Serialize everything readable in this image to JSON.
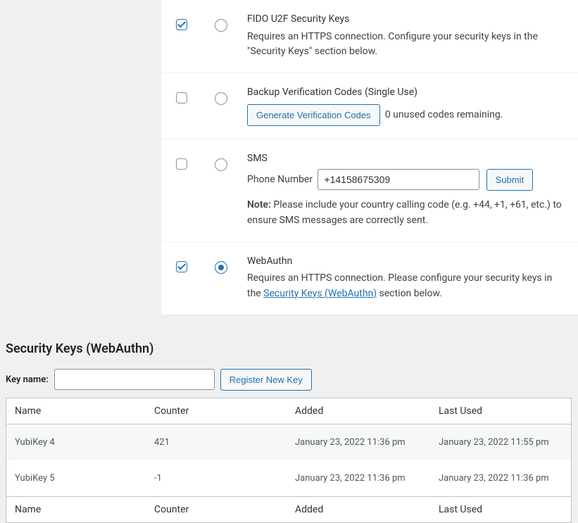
{
  "methods": {
    "fido": {
      "enabled": true,
      "primary": false,
      "title": "FIDO U2F Security Keys",
      "desc": "Requires an HTTPS connection. Configure your security keys in the \"Security Keys\" section below."
    },
    "backup": {
      "enabled": false,
      "primary": false,
      "title": "Backup Verification Codes (Single Use)",
      "generate_label": "Generate Verification Codes",
      "remaining_text": "0 unused codes remaining."
    },
    "sms": {
      "enabled": false,
      "primary": false,
      "title": "SMS",
      "phone_label": "Phone Number",
      "phone_value": "+14158675309",
      "submit_label": "Submit",
      "note_label": "Note:",
      "note_text": " Please include your country calling code (e.g. +44, +1, +61, etc.) to ensure SMS messages are correctly sent."
    },
    "webauthn": {
      "enabled": true,
      "primary": true,
      "title": "WebAuthn",
      "desc_pre": "Requires an HTTPS connection. Please configure your security keys in the ",
      "link_text": "Security Keys (WebAuthn)",
      "desc_post": " section below."
    }
  },
  "security_keys_section": {
    "heading": "Security Keys (WebAuthn)",
    "key_name_label": "Key name:",
    "register_button": "Register New Key",
    "columns": {
      "name": "Name",
      "counter": "Counter",
      "added": "Added",
      "last_used": "Last Used"
    },
    "rows": [
      {
        "name": "YubiKey 4",
        "counter": "421",
        "added": "January 23, 2022 11:36 pm",
        "last_used": "January 23, 2022 11:55 pm"
      },
      {
        "name": "YubiKey 5",
        "counter": "-1",
        "added": "January 23, 2022 11:36 pm",
        "last_used": "January 23, 2022 11:36 pm"
      }
    ]
  }
}
